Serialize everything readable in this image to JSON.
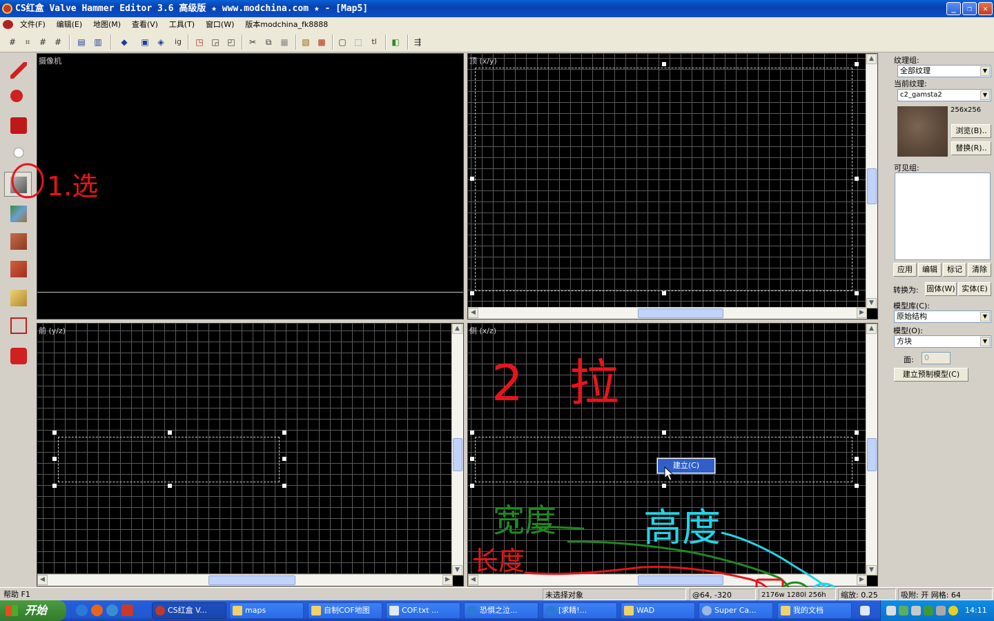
{
  "window": {
    "title": "CS红盒 Valve Hammer Editor 3.6 高级版 ★ www.modchina.com ★ - [Map5]",
    "minimize": "_",
    "restore": "❐",
    "close": "✕"
  },
  "menu": {
    "items": [
      "文件(F)",
      "编辑(E)",
      "地图(M)",
      "查看(V)",
      "工具(T)",
      "窗口(W)",
      "版本modchina_fk8888"
    ]
  },
  "toolbar": {
    "icons": [
      "grid-toggle-icon",
      "grid-3d-icon",
      "grid-smaller-icon",
      "grid-larger-icon",
      "group-icon",
      "ungroup-icon",
      "carve-icon",
      "hollow-icon",
      "tie-icon",
      "ignore-group-icon",
      "undo-icon",
      "redo-icon",
      "copy-view-icon",
      "cut-icon",
      "copy-icon",
      "paste-icon",
      "texture-lock-icon",
      "texture-apply-icon",
      "box-select-icon",
      "select-vertices-icon",
      "text-icon",
      "flip-icon",
      "align-icon"
    ],
    "text_glyph": "tl",
    "ig_glyph": "ig"
  },
  "tools": {
    "items": [
      "pointer-tool-icon",
      "magnify-tool-icon",
      "camera-tool-icon",
      "entity-tool-icon",
      "block-tool-icon",
      "texture-app-icon",
      "apply-texture-icon",
      "decal-icon",
      "clipping-tool-icon",
      "vertex-tool-icon",
      "path-icon"
    ],
    "selected_index": 4
  },
  "views": {
    "camera_label": "摄像机",
    "top_label": "顶 (x/y)",
    "front_label": "前 (y/z)",
    "side_label": "侧 (x/z)"
  },
  "context_menu": {
    "item": "建立(C)"
  },
  "right_panel": {
    "texture_group_label": "纹理组:",
    "texture_group_value": "全部纹理",
    "current_texture_label": "当前纹理:",
    "current_texture_value": "c2_gamsta2",
    "texture_size": "256x256",
    "browse_button": "浏览(B)..",
    "replace_button": "替换(R)..",
    "visgroup_label": "可见组:",
    "apply_button": "应用",
    "edit_button": "编辑",
    "mark_button": "标记",
    "purge_button": "清除",
    "convert_label": "转换为:",
    "world_button": "固体(W)",
    "entity_button": "实体(E)",
    "prefab_lib_label": "模型库(C):",
    "prefab_lib_value": "原始结构",
    "prefab_label": "模型(O):",
    "prefab_value": "方块",
    "faces_label": "面:",
    "faces_value": "0",
    "create_prefab_button": "建立预制模型(C)"
  },
  "statusbar": {
    "help": "帮助 F1",
    "selection": "未选择对象",
    "coords": "@64, -320",
    "size": "2176w 1280l 256h",
    "zoom": "缩放: 0.25",
    "snap": "吸附: 开 网格: 64"
  },
  "taskbar": {
    "start": "开始",
    "tasks": [
      "CS红盒 V...",
      "maps",
      "自制COF地图",
      "COF.txt ...",
      "恐惧之泣...",
      "[求精!...",
      "WAD",
      "Super Ca...",
      "我的文档"
    ],
    "clock": "14:11"
  },
  "annotations": {
    "step1": "1.选",
    "step2": "2 拉",
    "width": "宽度",
    "height": "高度",
    "length": "长度"
  },
  "colors": {
    "annotation_red": "#e8141b",
    "annotation_green": "#1f8a1f",
    "annotation_cyan": "#22d4e6"
  }
}
